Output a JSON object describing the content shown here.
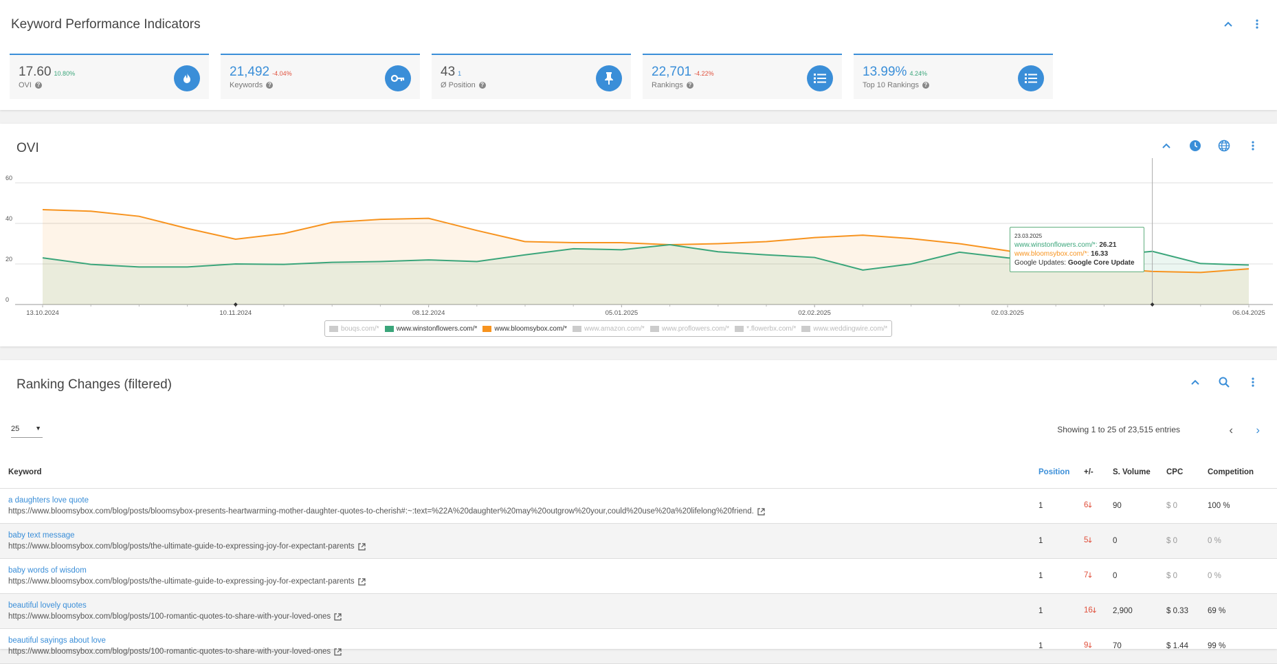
{
  "kpi_panel": {
    "title": "Keyword Performance Indicators",
    "cards": [
      {
        "value": "17.60",
        "delta": "10.80%",
        "delta_type": "pos",
        "label": "OVI",
        "icon": "fire-icon",
        "value_style": "dark"
      },
      {
        "value": "21,492",
        "delta": "-4.04%",
        "delta_type": "neg",
        "label": "Keywords",
        "icon": "key-icon",
        "value_style": "blue"
      },
      {
        "value": "43",
        "delta": "1",
        "delta_type": "neutral",
        "label": "Ø Position",
        "icon": "pin-icon",
        "value_style": "dark"
      },
      {
        "value": "22,701",
        "delta": "-4.22%",
        "delta_type": "neg",
        "label": "Rankings",
        "icon": "list-icon",
        "value_style": "blue"
      },
      {
        "value": "13.99%",
        "delta": "4.24%",
        "delta_type": "pos",
        "label": "Top 10 Rankings",
        "icon": "list-icon",
        "value_style": "blue"
      }
    ]
  },
  "ovi_panel": {
    "title": "OVI",
    "legend": [
      {
        "label": "bouqs.com/*",
        "color": "#cccccc",
        "active": false
      },
      {
        "label": "www.winstonflowers.com/*",
        "color": "#3aa57a",
        "active": true
      },
      {
        "label": "www.bloomsybox.com/*",
        "color": "#f7931e",
        "active": true
      },
      {
        "label": "www.amazon.com/*",
        "color": "#cccccc",
        "active": false
      },
      {
        "label": "www.proflowers.com/*",
        "color": "#cccccc",
        "active": false
      },
      {
        "label": "*.flowerbx.com/*",
        "color": "#cccccc",
        "active": false
      },
      {
        "label": "www.weddingwire.com/*",
        "color": "#cccccc",
        "active": false
      }
    ],
    "tooltip": {
      "date": "23.03.2025",
      "line1_label": "www.winstonflowers.com/*:",
      "line1_value": "26.21",
      "line2_label": "www.bloomsybox.com/*:",
      "line2_value": "16.33",
      "line3_label": "Google Updates:",
      "line3_value": "Google Core Update"
    }
  },
  "chart_data": {
    "type": "area",
    "ylim": [
      0,
      60
    ],
    "yticks": [
      "0",
      "20",
      "40",
      "60"
    ],
    "xtick_labels": [
      "13.10.2024",
      "10.11.2024",
      "08.12.2024",
      "05.01.2025",
      "02.02.2025",
      "02.03.2025",
      "06.04.2025"
    ],
    "x": [
      "13.10.2024",
      "20.10.2024",
      "27.10.2024",
      "03.11.2024",
      "10.11.2024",
      "17.11.2024",
      "24.11.2024",
      "01.12.2024",
      "08.12.2024",
      "15.12.2024",
      "22.12.2024",
      "29.12.2024",
      "05.01.2025",
      "12.01.2025",
      "19.01.2025",
      "26.01.2025",
      "02.02.2025",
      "09.02.2025",
      "16.02.2025",
      "23.02.2025",
      "02.03.2025",
      "09.03.2025",
      "16.03.2025",
      "23.03.2025",
      "30.03.2025",
      "06.04.2025"
    ],
    "series": [
      {
        "name": "www.bloomsybox.com/*",
        "color": "#f7931e",
        "values": [
          46.8,
          46,
          43.5,
          37.5,
          32.2,
          35,
          40.5,
          42,
          42.5,
          36.5,
          31,
          30.5,
          30.5,
          29.5,
          30,
          31,
          33,
          34.2,
          32.5,
          30,
          26.5,
          21.5,
          18,
          16.3,
          15.8,
          17.6
        ]
      },
      {
        "name": "www.winstonflowers.com/*",
        "color": "#3aa57a",
        "values": [
          23,
          19.8,
          18.5,
          18.5,
          20,
          19.8,
          20.8,
          21.2,
          22,
          21.2,
          24.5,
          27.5,
          27,
          29.5,
          26,
          24.5,
          23.2,
          17,
          20,
          25.8,
          23,
          21.5,
          24,
          26.21,
          20.2,
          19.5
        ]
      }
    ],
    "markers_on_axis": [
      "10.11.2024",
      "23.03.2025"
    ]
  },
  "rank_panel": {
    "title": "Ranking Changes (filtered)",
    "page_size": "25",
    "showing": "Showing 1 to 25 of 23,515 entries",
    "columns": {
      "keyword": "Keyword",
      "position": "Position",
      "change": "+/-",
      "volume": "S. Volume",
      "cpc": "CPC",
      "competition": "Competition"
    },
    "rows": [
      {
        "keyword": "a daughters love quote",
        "url": "https://www.bloomsybox.com/blog/posts/bloomsybox-presents-heartwarming-mother-daughter-quotes-to-cherish#:~:text=%22A%20daughter%20may%20outgrow%20your,could%20use%20a%20lifelong%20friend.",
        "position": "1",
        "change": "6",
        "volume": "90",
        "cpc": "$ 0",
        "competition": "100 %"
      },
      {
        "keyword": "baby text message",
        "url": "https://www.bloomsybox.com/blog/posts/the-ultimate-guide-to-expressing-joy-for-expectant-parents",
        "position": "1",
        "change": "5",
        "volume": "0",
        "cpc": "$ 0",
        "competition": "0 %"
      },
      {
        "keyword": "baby words of wisdom",
        "url": "https://www.bloomsybox.com/blog/posts/the-ultimate-guide-to-expressing-joy-for-expectant-parents",
        "position": "1",
        "change": "7",
        "volume": "0",
        "cpc": "$ 0",
        "competition": "0 %"
      },
      {
        "keyword": "beautiful lovely quotes",
        "url": "https://www.bloomsybox.com/blog/posts/100-romantic-quotes-to-share-with-your-loved-ones",
        "position": "1",
        "change": "16",
        "volume": "2,900",
        "cpc": "$ 0.33",
        "competition": "69 %"
      },
      {
        "keyword": "beautiful sayings about love",
        "url": "https://www.bloomsybox.com/blog/posts/100-romantic-quotes-to-share-with-your-loved-ones",
        "position": "1",
        "change": "9",
        "volume": "70",
        "cpc": "$ 1.44",
        "competition": "99 %"
      }
    ]
  }
}
